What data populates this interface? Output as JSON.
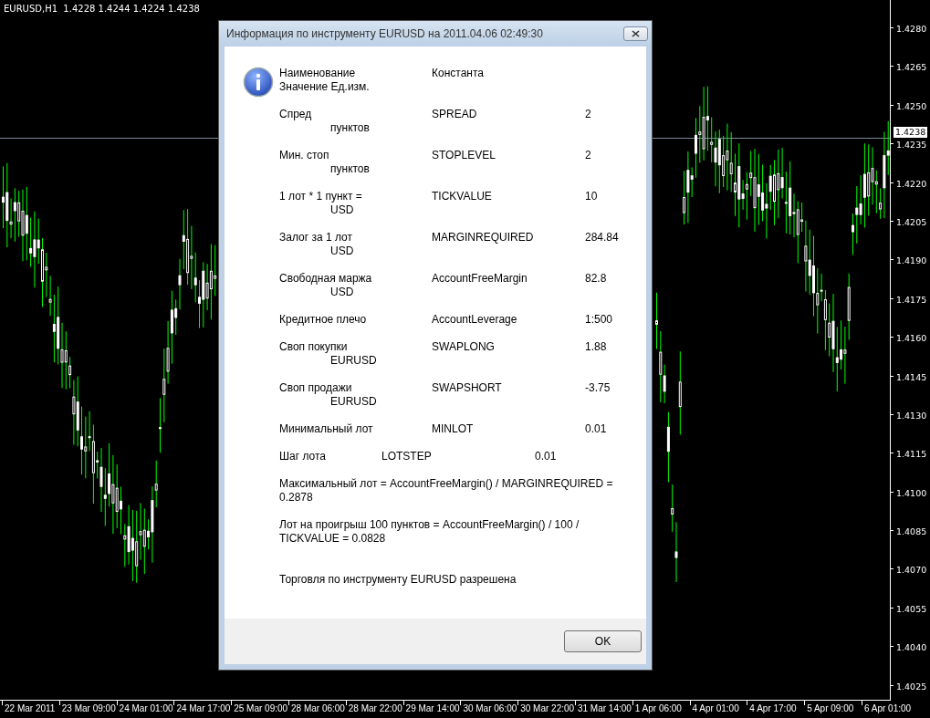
{
  "chart": {
    "title": "EURUSD,H1  1.4228 1.4244 1.4224 1.4238",
    "price_labels": [
      "1.4280",
      "1.4265",
      "1.4250",
      "1.4235",
      "1.4220",
      "1.4205",
      "1.4190",
      "1.4175",
      "1.4160",
      "1.4145",
      "1.4130",
      "1.4115",
      "1.4100",
      "1.4085",
      "1.4070",
      "1.4055",
      "1.4040",
      "1.4025"
    ],
    "current_price": "1.4238",
    "time_labels": [
      "22 Mar 2011",
      "23 Mar 09:00",
      "24 Mar 01:00",
      "24 Mar 17:00",
      "25 Mar 09:00",
      "28 Mar 06:00",
      "28 Mar 22:00",
      "29 Mar 14:00",
      "30 Mar 06:00",
      "30 Mar 22:00",
      "31 Mar 14:00",
      "1 Apr 06:00",
      "4 Apr 01:00",
      "4 Apr 17:00",
      "5 Apr 09:00",
      "6 Apr 01:00"
    ]
  },
  "dialog": {
    "title": "Информация по инструменту EURUSD на 2011.04.06 02:49:30",
    "header": {
      "name": "Наименование",
      "constant": "Константа",
      "sub": "Значение Ед.изм."
    },
    "rows": [
      {
        "kind": "pair",
        "name": "Спред",
        "constant": "SPREAD",
        "value": "2",
        "unit": "пунктов"
      },
      {
        "kind": "pair",
        "name": "Мин. стоп",
        "constant": "STOPLEVEL",
        "value": "2",
        "unit": "пунктов"
      },
      {
        "kind": "pair",
        "name": "1 лот * 1 пункт =",
        "constant": "TICKVALUE",
        "value": "10",
        "unit": "USD"
      },
      {
        "kind": "pair",
        "name": "Залог за 1 лот",
        "constant": "MARGINREQUIRED",
        "value": "284.84",
        "unit": "USD"
      },
      {
        "kind": "pair",
        "name": "Свободная маржа",
        "constant": "AccountFreeMargin",
        "value": "82.8",
        "unit": "USD"
      },
      {
        "kind": "pair",
        "name": "Кредитное плечо",
        "constant": "AccountLeverage",
        "value": "1:500"
      },
      {
        "kind": "pair",
        "name": "Своп покупки",
        "constant": "SWAPLONG",
        "value": "1.88",
        "unit": "EURUSD"
      },
      {
        "kind": "pair",
        "name": "Своп продажи",
        "constant": "SWAPSHORT",
        "value": "-3.75",
        "unit": "EURUSD"
      },
      {
        "kind": "pair",
        "name": "Минимальный лот",
        "constant": "MINLOT",
        "value": "0.01"
      },
      {
        "kind": "offset",
        "name": "Шаг лота",
        "constant": "LOTSTEP",
        "value": "0.01"
      }
    ],
    "formulas": [
      "Максимальный лот = AccountFreeMargin() / MARGINREQUIRED = 0.2878",
      "Лот на проигрыш 100 пунктов = AccountFreeMargin() / 100 / TICKVALUE = 0.0828"
    ],
    "status": "Торговля по инструменту EURUSD разрешена",
    "ok_button": "OK"
  }
}
